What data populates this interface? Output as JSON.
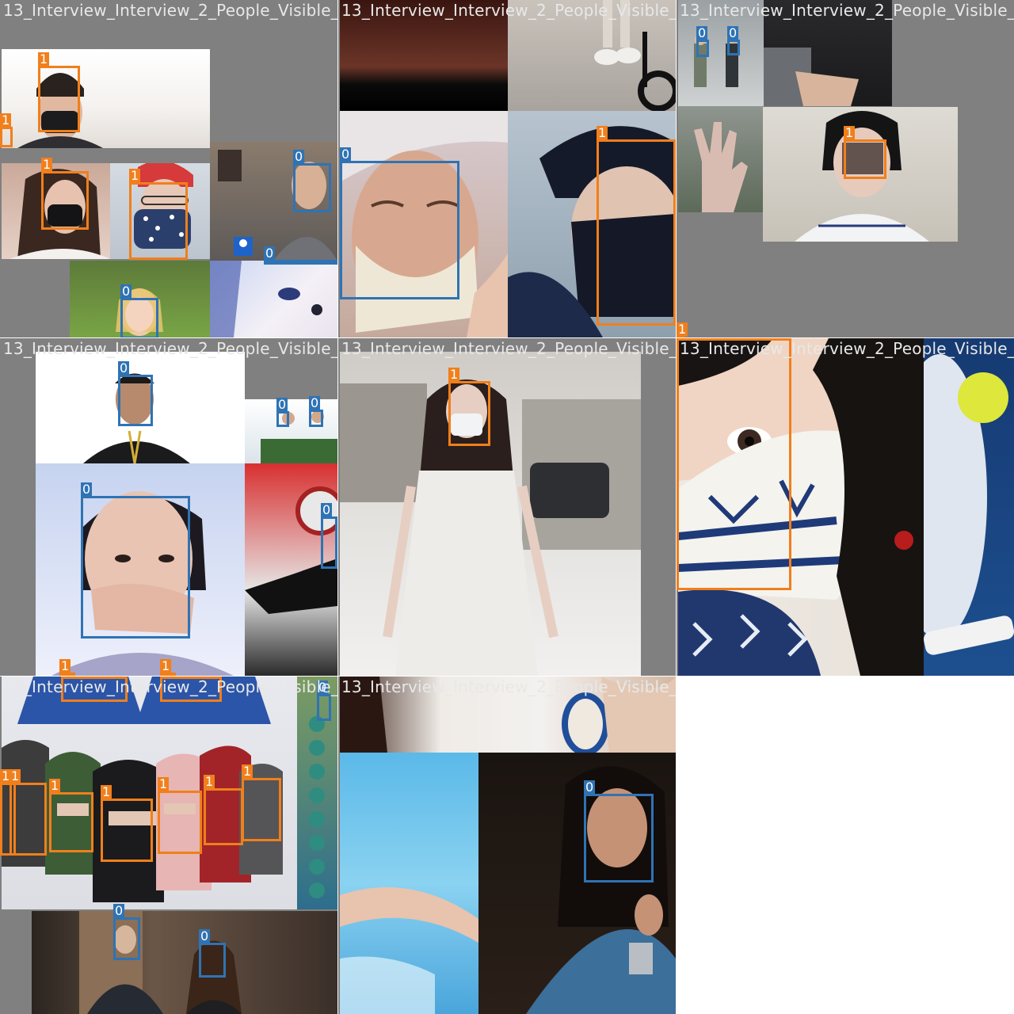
{
  "grid": {
    "tile_title": "13_Interview_Interview_2_People_Visible_",
    "class_colors": {
      "0": "#2f73b4",
      "1": "#f07f1c"
    }
  },
  "labels": {
    "zero": "0",
    "one": "1"
  },
  "tiles": [
    {
      "id": "tile-1",
      "description": "mosaic of masked faces"
    },
    {
      "id": "tile-2",
      "description": "facial mask and dark cap"
    },
    {
      "id": "tile-3",
      "description": "people in mesh mask"
    },
    {
      "id": "tile-4",
      "description": "man in leather jacket, girl covering mouth"
    },
    {
      "id": "tile-5",
      "description": "woman in white dress with surgical mask"
    },
    {
      "id": "tile-6",
      "description": "snowflake patterned face mask"
    },
    {
      "id": "tile-7",
      "description": "balaclavas on mannequins"
    },
    {
      "id": "tile-8",
      "description": "woman in blue top"
    }
  ]
}
